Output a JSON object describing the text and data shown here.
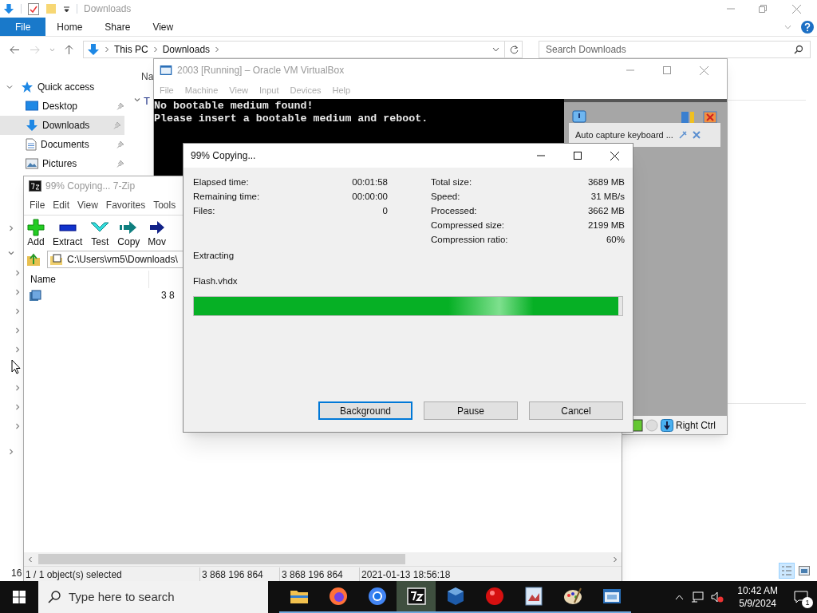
{
  "explorer": {
    "title": "Downloads",
    "ribbon_tabs": [
      {
        "label": "File",
        "selected": true
      },
      {
        "label": "Home",
        "selected": false
      },
      {
        "label": "Share",
        "selected": false
      },
      {
        "label": "View",
        "selected": false
      }
    ],
    "address": [
      "This PC",
      "Downloads"
    ],
    "search": {
      "placeholder": "Search Downloads"
    },
    "nav": [
      {
        "label": "Quick access",
        "kind": "group",
        "expanded": true,
        "selected": false
      },
      {
        "label": "Desktop",
        "kind": "desktop",
        "selected": false
      },
      {
        "label": "Downloads",
        "kind": "downloads",
        "selected": true
      },
      {
        "label": "Documents",
        "kind": "documents",
        "selected": false
      },
      {
        "label": "Pictures",
        "kind": "pictures",
        "selected": false
      }
    ],
    "column_header": "Na",
    "group_header": "T",
    "status": "16"
  },
  "virtualbox": {
    "title": "2003 [Running] – Oracle VM VirtualBox",
    "menu": [
      "File",
      "Machine",
      "View",
      "Input",
      "Devices",
      "Help"
    ],
    "console_lines": [
      "No bootable medium found!",
      "Please insert a bootable medium and reboot."
    ],
    "notification": "Auto capture keyboard ...",
    "host_key": "Right Ctrl"
  },
  "sevenzip": {
    "title": "99% Copying... 7-Zip",
    "menu": [
      "File",
      "Edit",
      "View",
      "Favorites",
      "Tools"
    ],
    "toolbar": [
      {
        "label": "Add",
        "kind": "add"
      },
      {
        "label": "Extract",
        "kind": "extract"
      },
      {
        "label": "Test",
        "kind": "test"
      },
      {
        "label": "Copy",
        "kind": "copy"
      },
      {
        "label": "Mov",
        "kind": "move"
      }
    ],
    "path": "C:\\Users\\vm5\\Downloads\\",
    "column": "Name",
    "row_size": "3 8",
    "status": [
      "1 / 1 object(s) selected",
      "3 868 196 864",
      "3 868 196 864",
      "2021-01-13 18:56:18"
    ]
  },
  "dialog": {
    "title": "99% Copying...",
    "left": [
      {
        "label": "Elapsed time:",
        "value": "00:01:58"
      },
      {
        "label": "Remaining time:",
        "value": "00:00:00"
      },
      {
        "label": "Files:",
        "value": "0"
      }
    ],
    "right": [
      {
        "label": "Total size:",
        "value": "3689 MB"
      },
      {
        "label": "Speed:",
        "value": "31 MB/s"
      },
      {
        "label": "Processed:",
        "value": "3662 MB"
      },
      {
        "label": "Compressed size:",
        "value": "2199 MB"
      },
      {
        "label": "Compression ratio:",
        "value": "60%"
      }
    ],
    "operation": "Extracting",
    "file": "Flash.vhdx",
    "progress": {
      "level": 0.99
    },
    "buttons": [
      {
        "label": "Background",
        "selected": true
      },
      {
        "label": "Pause",
        "selected": false
      },
      {
        "label": "Cancel",
        "selected": false
      }
    ]
  },
  "taskbar": {
    "search_placeholder": "Type here to search",
    "apps": [
      {
        "kind": "folder",
        "active": false
      },
      {
        "kind": "firefox",
        "active": false
      },
      {
        "kind": "chrome",
        "active": false
      },
      {
        "kind": "sevenzip",
        "active": true
      },
      {
        "kind": "virtualbox",
        "active": false
      },
      {
        "kind": "record",
        "active": false
      },
      {
        "kind": "document",
        "active": false
      },
      {
        "kind": "paint",
        "active": false
      },
      {
        "kind": "vm",
        "active": false
      }
    ],
    "time": "10:42 AM",
    "date": "5/9/2024",
    "notification_count": "1"
  }
}
